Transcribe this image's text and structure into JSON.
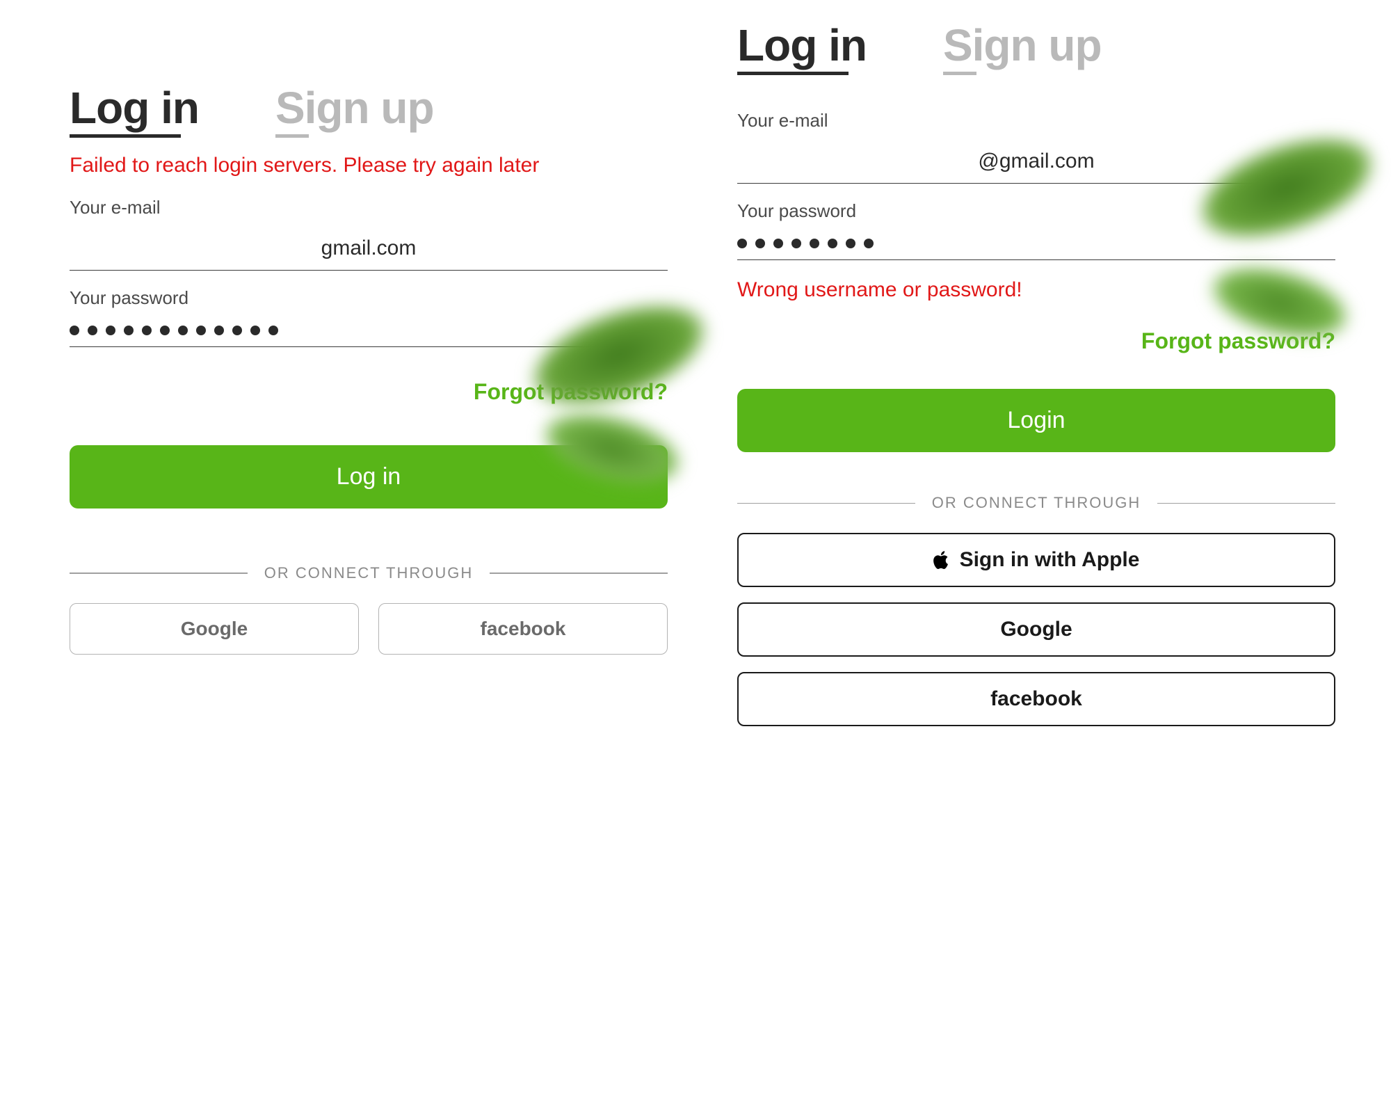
{
  "left": {
    "tabs": {
      "login": "Log in",
      "signup": "Sign up"
    },
    "error_top": "Failed to reach login servers. Please try again later",
    "email_label": "Your e-mail",
    "email_value": "gmail.com",
    "password_label": "Your password",
    "password_dots": 12,
    "forgot": "Forgot password?",
    "login_button": "Log in",
    "divider": "OR CONNECT THROUGH",
    "social": {
      "google": "Google",
      "facebook": "facebook"
    }
  },
  "right": {
    "tabs": {
      "login": "Log in",
      "signup": "Sign up"
    },
    "email_label": "Your e-mail",
    "email_value": "@gmail.com",
    "password_label": "Your password",
    "password_dots": 8,
    "error_below": "Wrong username or password!",
    "forgot": "Forgot password?",
    "login_button": "Login",
    "divider": "OR CONNECT THROUGH",
    "social": {
      "apple": "Sign in with Apple",
      "google": "Google",
      "facebook": "facebook"
    }
  },
  "colors": {
    "accent": "#58b518",
    "error": "#e11818"
  }
}
